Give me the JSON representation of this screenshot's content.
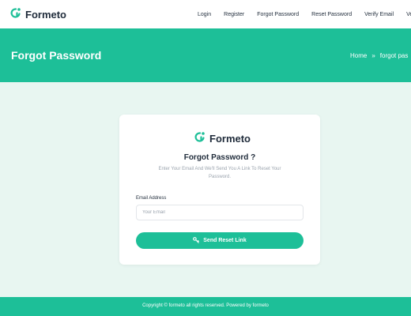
{
  "brand": {
    "name": "Formeto",
    "accent_color": "#1dbf98",
    "logo_icon": "formeto-logo-icon"
  },
  "nav": {
    "items": [
      {
        "label": "Login"
      },
      {
        "label": "Register"
      },
      {
        "label": "Forgot Password"
      },
      {
        "label": "Reset Password"
      },
      {
        "label": "Verify Email"
      },
      {
        "label": "Ve"
      }
    ]
  },
  "hero": {
    "title": "Forgot Password",
    "breadcrumb": {
      "home": "Home",
      "separator": "»",
      "current": "forgot pas"
    }
  },
  "card": {
    "brand_name": "Formeto",
    "title": "Forgot Password ?",
    "description": "Enter Your Email And We'll Send You A Link To Reset Your Password.",
    "email_label": "Email Address",
    "email_placeholder": "Your Email",
    "email_value": "",
    "submit_label": "Send Reset Link",
    "submit_icon": "key-icon"
  },
  "footer": {
    "text": "Copyright © formeto all rights reserved. Powered by formeto"
  }
}
